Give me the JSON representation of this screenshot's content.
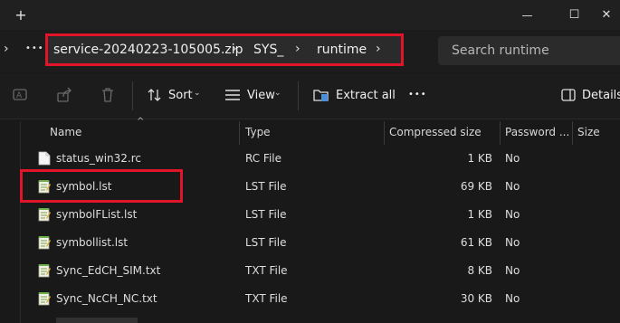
{
  "titlebar": {
    "new_tab": "+",
    "minimize": "—",
    "maximize": "☐",
    "close": "✕"
  },
  "address": {
    "more": "•••",
    "crumbs": [
      "service-20240223-105005.zip",
      "SYS_",
      "runtime"
    ],
    "search_placeholder": "Search runtime"
  },
  "toolbar": {
    "sort_label": "Sort",
    "view_label": "View",
    "extract_label": "Extract all",
    "more": "•••",
    "details_label": "Details"
  },
  "columns": {
    "name": "Name",
    "type": "Type",
    "compressed": "Compressed size",
    "password": "Password ...",
    "size": "Size"
  },
  "files": [
    {
      "name": "status_win32.rc",
      "type": "RC File",
      "compressed": "1 KB",
      "password": "No",
      "icon": "blank-file-icon"
    },
    {
      "name": "symbol.lst",
      "type": "LST File",
      "compressed": "69 KB",
      "password": "No",
      "icon": "notepad-file-icon"
    },
    {
      "name": "symbolFList.lst",
      "type": "LST File",
      "compressed": "1 KB",
      "password": "No",
      "icon": "notepad-file-icon"
    },
    {
      "name": "symbollist.lst",
      "type": "LST File",
      "compressed": "61 KB",
      "password": "No",
      "icon": "notepad-file-icon"
    },
    {
      "name": "Sync_EdCH_SIM.txt",
      "type": "TXT File",
      "compressed": "8 KB",
      "password": "No",
      "icon": "notepad-file-icon"
    },
    {
      "name": "Sync_NcCH_NC.txt",
      "type": "TXT File",
      "compressed": "30 KB",
      "password": "No",
      "icon": "notepad-file-icon"
    }
  ],
  "colors": {
    "highlight": "#e0152a",
    "background": "#191919"
  }
}
